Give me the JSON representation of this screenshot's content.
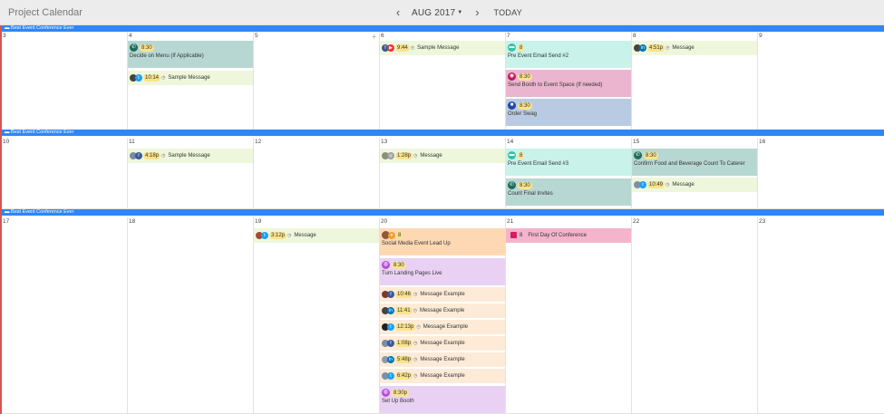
{
  "app": {
    "title": "Project Calendar"
  },
  "nav": {
    "month": "AUG 2017",
    "today": "TODAY"
  },
  "banner": "Best Event Conference Ever",
  "weeks": [
    {
      "days": [
        "3",
        "4",
        "5",
        "6",
        "7",
        "8",
        "9"
      ]
    },
    {
      "days": [
        "10",
        "11",
        "12",
        "13",
        "14",
        "15",
        "16"
      ]
    },
    {
      "days": [
        "17",
        "18",
        "19",
        "20",
        "21",
        "22",
        "23"
      ]
    }
  ],
  "events": {
    "d4a": {
      "time": "8:30",
      "title": "Decide on Menu (If Applicable)"
    },
    "d4b": {
      "time": "10:14",
      "msg": "Sample Message"
    },
    "d6a": {
      "time": "9:44",
      "msg": "Sample Message"
    },
    "d7a": {
      "time": "8",
      "title": "Pre Event Email Send #2"
    },
    "d7b": {
      "time": "8:30",
      "title": "Send Booth to Event Space (If needed)"
    },
    "d7c": {
      "time": "8:30",
      "title": "Order Swag"
    },
    "d8a": {
      "time": "4:51p",
      "msg": "Message"
    },
    "d11a": {
      "time": "4:18p",
      "msg": "Sample Message"
    },
    "d13a": {
      "time": "1:28p",
      "msg": "Message"
    },
    "d14a": {
      "time": "8",
      "title": "Pre Event Email Send #3"
    },
    "d14b": {
      "time": "8:30",
      "title": "Count Final Invites"
    },
    "d15a": {
      "time": "8:30",
      "title": "Confirm Food and Beverage Count To Caterer"
    },
    "d15b": {
      "time": "10:49",
      "msg": "Message"
    },
    "d19a": {
      "time": "3:12p",
      "msg": "Message"
    },
    "d20a": {
      "time": "8",
      "title": "Social Media Event Lead Up"
    },
    "d20b": {
      "time": "8:30",
      "title": "Turn Landing Pages Live"
    },
    "d20c": {
      "time": "10:46",
      "msg": "Message Example"
    },
    "d20d": {
      "time": "11:41",
      "msg": "Message Example"
    },
    "d20e": {
      "time": "12:13p",
      "msg": "Message Example"
    },
    "d20f": {
      "time": "1:08p",
      "msg": "Message Example"
    },
    "d20g": {
      "time": "5:48p",
      "msg": "Message Example"
    },
    "d20h": {
      "time": "6:42p",
      "msg": "Message Example"
    },
    "d20i": {
      "time": "8:30p",
      "title": "Set Up Booth"
    },
    "d21a": {
      "time": "8",
      "msg": "First Day Of Conference"
    }
  },
  "icons": {
    "phone": "phone-icon",
    "chat": "chat-icon",
    "pin": "pin-icon",
    "task": "task-icon",
    "calendar": "calendar-icon",
    "web": "web-icon"
  },
  "colors": {
    "banner": "#2f86f6",
    "accent_border": "#d9534f",
    "time_pill": "#fbe38b"
  }
}
